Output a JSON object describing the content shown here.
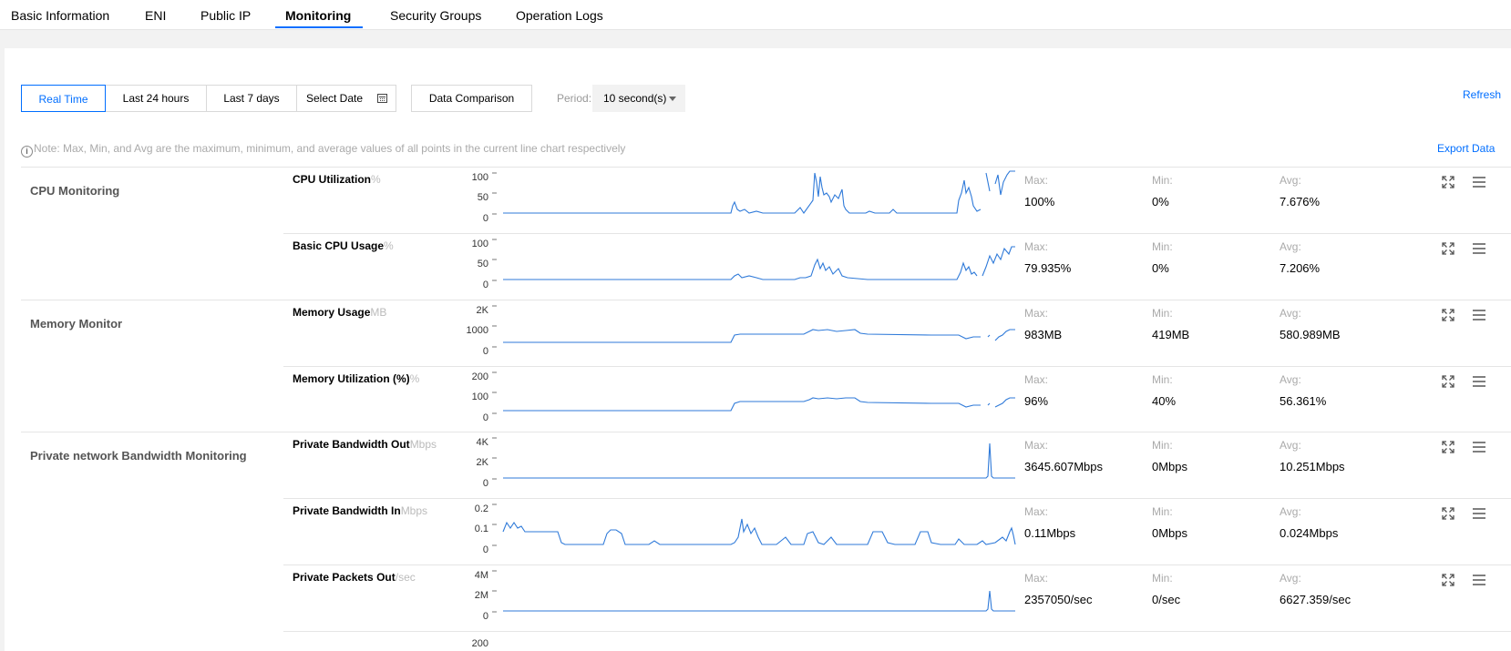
{
  "tabs": [
    {
      "label": "Basic Information"
    },
    {
      "label": "ENI"
    },
    {
      "label": "Public IP"
    },
    {
      "label": "Monitoring",
      "active": true
    },
    {
      "label": "Security Groups"
    },
    {
      "label": "Operation Logs"
    }
  ],
  "toolbar": {
    "ranges": [
      "Real Time",
      "Last 24 hours",
      "Last 7 days"
    ],
    "select_date": "Select Date",
    "data_comparison": "Data Comparison",
    "period_label": "Period:",
    "period_value": "10 second(s)",
    "refresh": "Refresh"
  },
  "note": "Note: Max, Min, and Avg are the maximum, minimum, and average values of all points in the current line chart respectively",
  "export": "Export Data",
  "stat_labels": {
    "max": "Max:",
    "min": "Min:",
    "avg": "Avg:"
  },
  "colors": {
    "accent": "#006eff",
    "line": "#2f7ad9"
  },
  "groups": [
    {
      "title": "CPU Monitoring"
    },
    {
      "title": "Memory Monitor"
    },
    {
      "title": "Private network Bandwidth Monitoring"
    }
  ],
  "metrics": [
    {
      "name": "CPU Utilization",
      "unit": "%",
      "yticks": [
        "100",
        "50",
        "0"
      ],
      "max": "100%",
      "min": "0%",
      "avg": "7.676%"
    },
    {
      "name": "Basic CPU Usage",
      "unit": "%",
      "yticks": [
        "100",
        "50",
        "0"
      ],
      "max": "79.935%",
      "min": "0%",
      "avg": "7.206%"
    },
    {
      "name": "Memory Usage",
      "unit": "MB",
      "yticks": [
        "2K",
        "1000",
        "0"
      ],
      "max": "983MB",
      "min": "419MB",
      "avg": "580.989MB"
    },
    {
      "name": "Memory Utilization (%)",
      "unit": "%",
      "yticks": [
        "200",
        "100",
        "0"
      ],
      "max": "96%",
      "min": "40%",
      "avg": "56.361%"
    },
    {
      "name": "Private Bandwidth Out",
      "unit": "Mbps",
      "yticks": [
        "4K",
        "2K",
        "0"
      ],
      "max": "3645.607Mbps",
      "min": "0Mbps",
      "avg": "10.251Mbps"
    },
    {
      "name": "Private Bandwidth In",
      "unit": "Mbps",
      "yticks": [
        "0.2",
        "0.1",
        "0"
      ],
      "max": "0.11Mbps",
      "min": "0Mbps",
      "avg": "0.024Mbps"
    },
    {
      "name": "Private Packets Out",
      "unit": "/sec",
      "yticks": [
        "4M",
        "2M",
        "0"
      ],
      "max": "2357050/sec",
      "min": "0/sec",
      "avg": "6627.359/sec"
    }
  ],
  "partial_next_tick": "200"
}
